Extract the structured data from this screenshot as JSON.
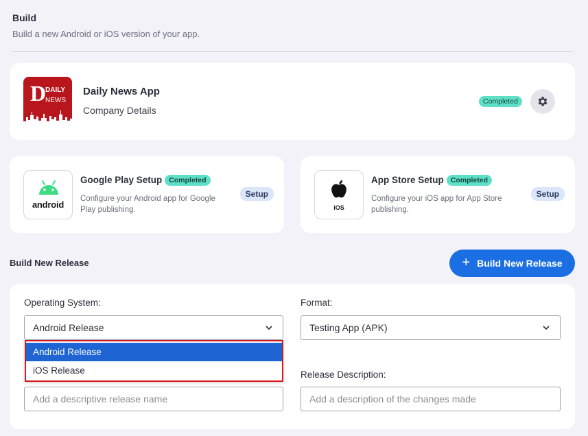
{
  "header": {
    "title": "Build",
    "subtitle": "Build a new Android or iOS version of your app."
  },
  "app": {
    "name": "Daily News App",
    "company": "Company Details",
    "status": "Completed",
    "logo": {
      "letter": "D",
      "line1": "DAILY",
      "line2": "NEWS",
      "color": "#b8151c"
    }
  },
  "google_play": {
    "title": "Google Play Setup",
    "status": "Completed",
    "description": "Configure your Android app for Google Play publishing.",
    "button": "Setup",
    "icon_label": "android"
  },
  "app_store": {
    "title": "App Store Setup",
    "status": "Completed",
    "description": "Configure your iOS app for App Store publishing.",
    "button": "Setup",
    "icon_label": "iOS"
  },
  "release": {
    "section_title": "Build New Release",
    "button_label": "Build New Release",
    "os_label": "Operating System:",
    "os_value": "Android Release",
    "os_options": [
      "Android Release",
      "iOS Release"
    ],
    "format_label": "Format:",
    "format_value": "Testing App (APK)",
    "description_label": "Release Description:",
    "name_placeholder": "Add a descriptive release name",
    "description_placeholder": "Add a description of the changes made"
  },
  "colors": {
    "accent": "#1b6fe3",
    "badge": "#5ee0c8",
    "highlight": "#d8171d",
    "android_green": "#3ddc84"
  }
}
